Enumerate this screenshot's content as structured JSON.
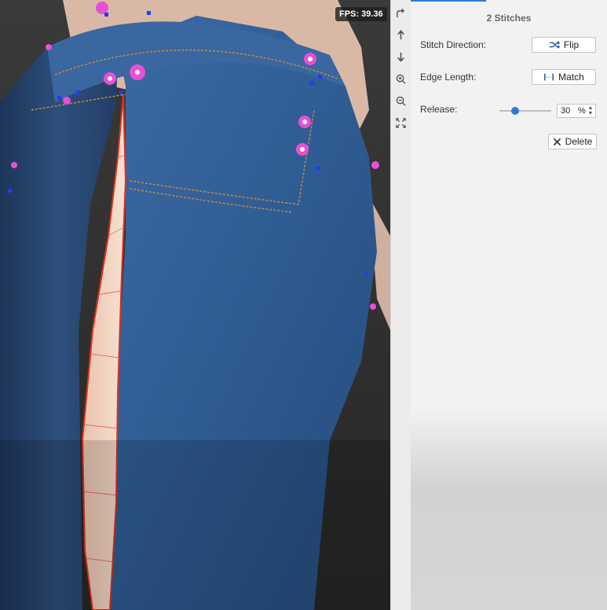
{
  "viewport": {
    "fps_text": "FPS: 39.36"
  },
  "toolbar": {
    "buttons": [
      {
        "icon": "redirect-icon"
      },
      {
        "icon": "arrow-up-icon"
      },
      {
        "icon": "arrow-down-icon"
      },
      {
        "icon": "zoom-in-icon"
      },
      {
        "icon": "zoom-out-icon"
      },
      {
        "icon": "fit-view-icon"
      }
    ]
  },
  "panel": {
    "title": "2 Stitches",
    "stitch_direction": {
      "label": "Stitch Direction:",
      "button_label": "Flip",
      "icon": "shuffle-icon"
    },
    "edge_length": {
      "label": "Edge Length:",
      "button_label": "Match",
      "icon": "ruler-icon"
    },
    "release": {
      "label": "Release:",
      "value": "30",
      "unit": "%",
      "level": 0.3
    },
    "delete": {
      "label": "Delete",
      "icon": "close-icon"
    }
  },
  "colors": {
    "accent": "#2c7bd8",
    "denim": "#2f5a8f",
    "denim_dark": "#1e3f6b",
    "stitch_line": "#e0301e",
    "pin": "#e84fd6",
    "skin": "#f3d7c5"
  }
}
